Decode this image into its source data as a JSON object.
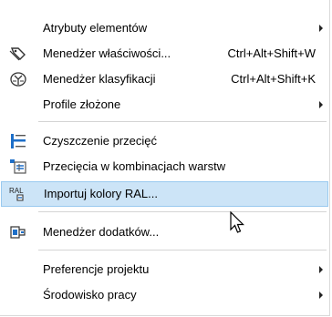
{
  "menu": {
    "items": [
      {
        "label": "Atrybuty elementów",
        "shortcut": "",
        "submenu": true,
        "icon": "none"
      },
      {
        "label": "Menedżer właściwości...",
        "shortcut": "Ctrl+Alt+Shift+W",
        "submenu": false,
        "icon": "property-manager-icon"
      },
      {
        "label": "Menedżer klasyfikacji",
        "shortcut": "Ctrl+Alt+Shift+K",
        "submenu": false,
        "icon": "classification-manager-icon"
      },
      {
        "label": "Profile złożone",
        "shortcut": "",
        "submenu": true,
        "icon": "none"
      },
      {
        "label": "Czyszczenie przecięć",
        "shortcut": "",
        "submenu": false,
        "icon": "clean-intersections-icon"
      },
      {
        "label": "Przecięcia w kombinacjach warstw",
        "shortcut": "",
        "submenu": false,
        "icon": "layer-intersections-icon"
      },
      {
        "label": "Importuj kolory RAL...",
        "shortcut": "",
        "submenu": false,
        "icon": "ral-colors-icon",
        "highlighted": true
      },
      {
        "label": "Menedżer dodatków...",
        "shortcut": "",
        "submenu": false,
        "icon": "add-on-manager-icon"
      },
      {
        "label": "Preferencje projektu",
        "shortcut": "",
        "submenu": true,
        "icon": "none"
      },
      {
        "label": "Środowisko pracy",
        "shortcut": "",
        "submenu": true,
        "icon": "none"
      }
    ]
  },
  "colors": {
    "hover_background": "#cce4f7",
    "hover_border": "#99c9ef",
    "icon_blue": "#1e6fc8"
  }
}
